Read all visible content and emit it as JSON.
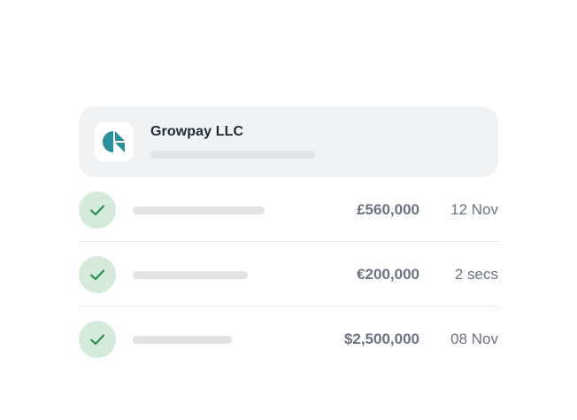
{
  "company": {
    "name": "Growpay LLC",
    "logo_icon": "growpay-logo-icon",
    "logo_color": "#2a8f9b"
  },
  "transactions": [
    {
      "status_icon": "check-icon",
      "amount": "£560,000",
      "time": "12 Nov"
    },
    {
      "status_icon": "check-icon",
      "amount": "€200,000",
      "time": "2 secs"
    },
    {
      "status_icon": "check-icon",
      "amount": "$2,500,000",
      "time": "08 Nov"
    }
  ],
  "colors": {
    "success_bg": "#d4eadb",
    "success_check": "#1f8a4c",
    "muted_text": "#6b7280",
    "skeleton": "#e1e3e5"
  }
}
